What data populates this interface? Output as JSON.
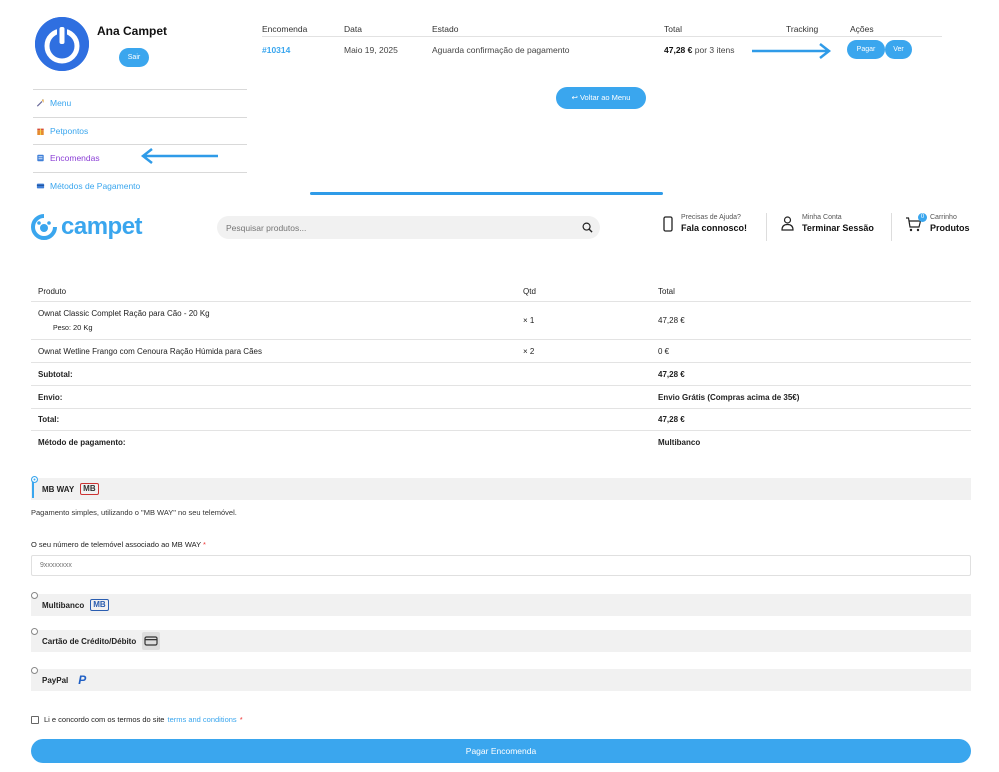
{
  "account": {
    "name": "Ana Campet",
    "logout_label": "Sair"
  },
  "sidebar": {
    "items": [
      {
        "label": "Menu"
      },
      {
        "label": "Petpontos"
      },
      {
        "label": "Encomendas",
        "active": true
      },
      {
        "label": "Métodos de Pagamento"
      }
    ]
  },
  "orders": {
    "headers": [
      "Encomenda",
      "Data",
      "Estado",
      "Total",
      "Tracking",
      "Ações"
    ],
    "rows": [
      {
        "number": "#10314",
        "date": "Maio 19, 2025",
        "status": "Aguarda confirmação de pagamento",
        "total_amount": "47,28 €",
        "total_suffix": "por 3 itens",
        "tracking": "",
        "pay_label": "Pagar",
        "view_label": "Ver"
      }
    ],
    "back_label": "↩ Voltar ao Menu"
  },
  "header": {
    "logo_text": "campet",
    "search_placeholder": "Pesquisar produtos...",
    "help_small": "Precisas de Ajuda?",
    "help_big": "Fala connosco!",
    "account_small": "Minha Conta",
    "account_big": "Terminar Sessão",
    "cart_small": "Carrinho",
    "cart_big": "Produtos",
    "cart_count": "0"
  },
  "order_detail": {
    "headers": {
      "product": "Produto",
      "qty": "Qtd",
      "total": "Total"
    },
    "items": [
      {
        "name": "Ownat Classic Complet Ração para Cão - 20 Kg",
        "meta_label": "Peso:",
        "meta_value": "20 Kg",
        "qty": "× 1",
        "total": "47,28 €"
      },
      {
        "name": "Ownat Wetline Frango com Cenoura Ração Húmida para Cães",
        "qty": "× 2",
        "total": "0 €"
      }
    ],
    "summary": [
      {
        "label": "Subtotal:",
        "value": "47,28 €"
      },
      {
        "label": "Envio:",
        "value": "Envio Grátis (Compras acima de 35€)"
      },
      {
        "label": "Total:",
        "value": "47,28 €"
      },
      {
        "label": "Método de pagamento:",
        "value": "Multibanco"
      }
    ]
  },
  "payment": {
    "mbway": {
      "label": "MB WAY",
      "logo": "MB",
      "description": "Pagamento simples, utilizando o \"MB WAY\" no seu telemóvel.",
      "field_label": "O seu número de telemóvel associado ao MB WAY",
      "required_mark": "*",
      "placeholder": "9xxxxxxxx"
    },
    "multibanco": {
      "label": "Multibanco",
      "logo": "MB"
    },
    "card": {
      "label": "Cartão de Crédito/Débito"
    },
    "paypal": {
      "label": "PayPal",
      "logo": "P"
    },
    "terms_text": "Li e concordo com os termos do site",
    "terms_link": "terms and conditions",
    "terms_required": "*",
    "submit_label": "Pagar Encomenda"
  },
  "colors": {
    "accent": "#3aa6ee",
    "active_menu": "#8b3fd6",
    "avatar_blue": "#2f6fe0"
  }
}
